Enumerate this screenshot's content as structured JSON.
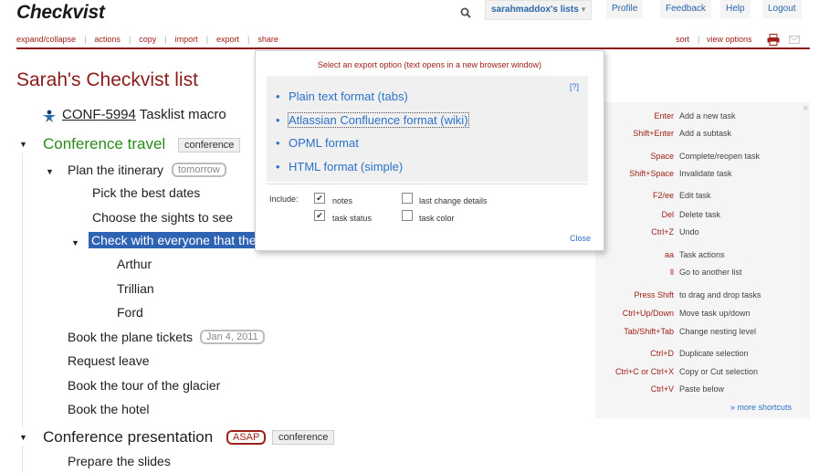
{
  "header": {
    "logo": "Checkvist",
    "user_menu": "sarahmaddox's lists",
    "links": [
      "Profile",
      "Feedback",
      "Help",
      "Logout"
    ]
  },
  "toolbar": {
    "items": [
      "expand/collapse",
      "actions",
      "copy",
      "import",
      "export",
      "share"
    ],
    "right_items": [
      "sort",
      "view options"
    ]
  },
  "list": {
    "title": "Sarah's Checkvist list",
    "macro_prefix": "CONF-5994",
    "macro_rest": " Tasklist macro",
    "conf_travel": "Conference travel",
    "conf_travel_tag": "conference",
    "itinerary": "Plan the itinerary",
    "itinerary_tag": "tomorrow",
    "pick_dates": "Pick the best dates",
    "sights": "Choose the sights to see",
    "check_everyone": "Check with everyone that the",
    "arthur": "Arthur",
    "trillian": "Trillian",
    "ford": "Ford",
    "plane": "Book the plane tickets",
    "plane_tag": "Jan 4, 2011",
    "leave": "Request leave",
    "glacier": "Book the tour of the glacier",
    "hotel": "Book the hotel",
    "presentation": "Conference presentation",
    "presentation_tag1": "ASAP",
    "presentation_tag2": "conference",
    "slides": "Prepare the slides"
  },
  "shortcuts": {
    "close": "×",
    "items": [
      {
        "key": "Enter",
        "desc": "Add a new task"
      },
      {
        "key": "Shift+Enter",
        "desc": "Add a subtask"
      },
      {
        "key": "Space",
        "desc": "Complete/reopen task"
      },
      {
        "key": "Shift+Space",
        "desc": "Invalidate task"
      },
      {
        "key": "F2/ee",
        "desc": "Edit task"
      },
      {
        "key": "Del",
        "desc": "Delete task"
      },
      {
        "key": "Ctrl+Z",
        "desc": "Undo"
      },
      {
        "key": "aa",
        "desc": "Task actions"
      },
      {
        "key": "ll",
        "desc": "Go to another list"
      },
      {
        "key": "Press Shift",
        "desc": "to drag and drop tasks"
      },
      {
        "key": "Ctrl+Up/Down",
        "desc": "Move task up/down"
      },
      {
        "key": "Tab/Shift+Tab",
        "desc": "Change nesting level"
      },
      {
        "key": "Ctrl+D",
        "desc": "Duplicate selection"
      },
      {
        "key": "Ctrl+C or Ctrl+X",
        "desc": "Copy or Cut selection"
      },
      {
        "key": "Ctrl+V",
        "desc": "Paste below"
      }
    ],
    "more": "» more shortcuts"
  },
  "export_popup": {
    "heading": "Select an export option (text opens in a new browser window)",
    "help": "[?]",
    "options": [
      "Plain text format (tabs)",
      "Atlassian Confluence format (wiki)",
      "OPML format",
      "HTML format (simple)"
    ],
    "include_label": "Include:",
    "checks": [
      {
        "label": "notes",
        "checked": true
      },
      {
        "label": "last change details",
        "checked": false
      },
      {
        "label": "task status",
        "checked": true
      },
      {
        "label": "task color",
        "checked": false
      }
    ],
    "close": "Close"
  },
  "colors": {
    "accent": "#9e2018",
    "link": "#2a72c8",
    "selection": "#2e62b3",
    "conference_green": "#2a8a1a"
  }
}
